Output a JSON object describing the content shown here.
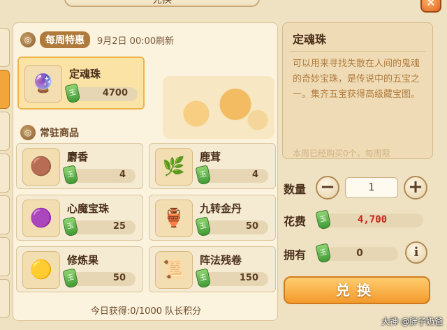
{
  "window": {
    "title": "兑换",
    "close_symbol": "✕"
  },
  "weekly": {
    "icon": "swirl-icon",
    "label": "每周特惠",
    "refresh": "9月2日 00:00刷新",
    "item": {
      "name": "定魂珠",
      "price": "4700",
      "icon_glyph": "🔮"
    }
  },
  "regular": {
    "icon": "swirl-icon",
    "label": "常驻商品",
    "items": [
      {
        "name": "麝香",
        "price": "4",
        "icon_glyph": "🟤"
      },
      {
        "name": "鹿茸",
        "price": "4",
        "icon_glyph": "🌿"
      },
      {
        "name": "心魔宝珠",
        "price": "25",
        "icon_glyph": "🟣"
      },
      {
        "name": "九转金丹",
        "price": "50",
        "icon_glyph": "🏺"
      },
      {
        "name": "修炼果",
        "price": "50",
        "icon_glyph": "🟡"
      },
      {
        "name": "阵法残卷",
        "price": "150",
        "icon_glyph": "📜"
      }
    ]
  },
  "daily": "今日获得:0/1000 队长积分",
  "detail": {
    "title": "定魂珠",
    "description": "可以用来寻找失散在人间的鬼魂的奇妙宝珠，是传说中的五宝之一。集齐五宝获得高级藏宝图。",
    "extra": "本周已经购买0个，每周限"
  },
  "quantity": {
    "label": "数量",
    "value": "1",
    "minus": "−",
    "plus": "+"
  },
  "cost": {
    "label": "花费",
    "value": "4,700"
  },
  "owned": {
    "label": "拥有",
    "value": "0"
  },
  "info_symbol": "i",
  "exchange_label": "兑换",
  "watermark": "大神 @胖子奶爸",
  "colors": {
    "accent": "#f39a2c",
    "cost_red": "#c8241a",
    "jade": "#3f9a35"
  }
}
